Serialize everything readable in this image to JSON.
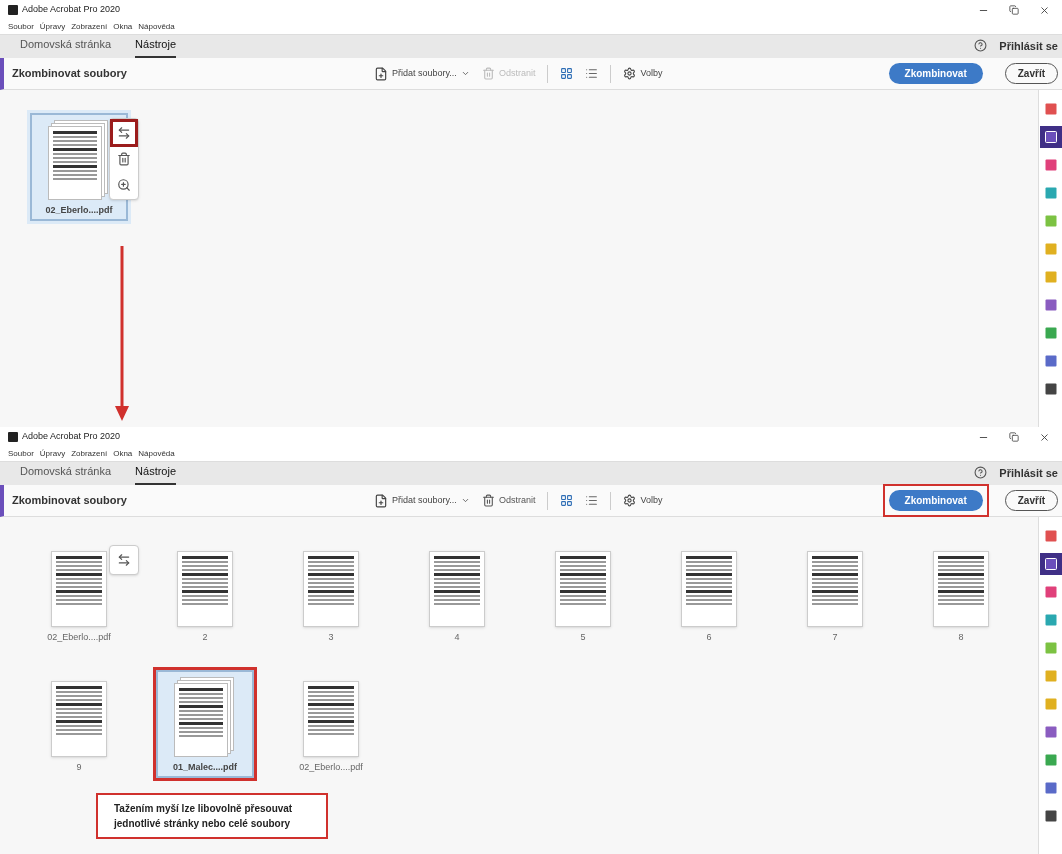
{
  "windows": [
    {
      "title": "Adobe Acrobat Pro 2020",
      "menu": [
        "Soubor",
        "Úpravy",
        "Zobrazení",
        "Okna",
        "Nápověda"
      ],
      "tabs": [
        {
          "label": "Domovská stránka",
          "selected": false
        },
        {
          "label": "Nástroje",
          "selected": true
        }
      ],
      "sign_in": "Přihlásit se",
      "toolbar": {
        "title": "Zkombinovat soubory",
        "add_files": "Přidat soubory...",
        "remove": {
          "label": "Odstranit",
          "disabled": true
        },
        "view_modes": [
          {
            "kind": "grid",
            "selected": true
          },
          {
            "kind": "list",
            "selected": false
          }
        ],
        "options": "Volby"
      },
      "combine_button": {
        "label": "Zkombinovat",
        "highlighted": false
      },
      "close_button": "Zavřít",
      "tools": [
        {
          "color": "#e05050",
          "selected": false
        },
        {
          "color": "#6b4fbb",
          "selected": true
        },
        {
          "color": "#e0407a",
          "selected": false
        },
        {
          "color": "#2aa8b0",
          "selected": false
        },
        {
          "color": "#7cc242",
          "selected": false
        },
        {
          "color": "#e0b020",
          "selected": false
        },
        {
          "color": "#e0b020",
          "selected": false
        },
        {
          "color": "#8a5cc0",
          "selected": false
        },
        {
          "color": "#3aa850",
          "selected": false
        },
        {
          "color": "#5a6ac8",
          "selected": false
        },
        {
          "color": "#444444",
          "selected": false
        }
      ],
      "rows": [
        [
          {
            "label": "02_Eberlo....pdf",
            "kind": "file",
            "selected": true,
            "highlighted": false,
            "actions": [
              {
                "kind": "swap",
                "highlighted": true
              },
              {
                "kind": "delete",
                "highlighted": false
              },
              {
                "kind": "zoom",
                "highlighted": false
              }
            ]
          }
        ]
      ]
    },
    {
      "title": "Adobe Acrobat Pro 2020",
      "menu": [
        "Soubor",
        "Úpravy",
        "Zobrazení",
        "Okna",
        "Nápověda"
      ],
      "tabs": [
        {
          "label": "Domovská stránka",
          "selected": false
        },
        {
          "label": "Nástroje",
          "selected": true
        }
      ],
      "sign_in": "Přihlásit se",
      "toolbar": {
        "title": "Zkombinovat soubory",
        "add_files": "Přidat soubory...",
        "remove": {
          "label": "Odstranit",
          "disabled": false
        },
        "view_modes": [
          {
            "kind": "grid",
            "selected": true
          },
          {
            "kind": "list",
            "selected": false
          }
        ],
        "options": "Volby"
      },
      "combine_button": {
        "label": "Zkombinovat",
        "highlighted": true
      },
      "close_button": "Zavřít",
      "tools": [
        {
          "color": "#e05050",
          "selected": false
        },
        {
          "color": "#6b4fbb",
          "selected": true
        },
        {
          "color": "#e0407a",
          "selected": false
        },
        {
          "color": "#2aa8b0",
          "selected": false
        },
        {
          "color": "#7cc242",
          "selected": false
        },
        {
          "color": "#e0b020",
          "selected": false
        },
        {
          "color": "#e0b020",
          "selected": false
        },
        {
          "color": "#8a5cc0",
          "selected": false
        },
        {
          "color": "#3aa850",
          "selected": false
        },
        {
          "color": "#5a6ac8",
          "selected": false
        },
        {
          "color": "#444444",
          "selected": false
        }
      ],
      "rows": [
        [
          {
            "label": "02_Eberlo....pdf",
            "kind": "page",
            "selected": false,
            "highlighted": false,
            "actions": [
              {
                "kind": "swap",
                "highlighted": false
              }
            ]
          },
          {
            "label": "2",
            "kind": "page",
            "selected": false,
            "highlighted": false
          },
          {
            "label": "3",
            "kind": "page",
            "selected": false,
            "highlighted": false
          },
          {
            "label": "4",
            "kind": "page",
            "selected": false,
            "highlighted": false
          },
          {
            "label": "5",
            "kind": "page",
            "selected": false,
            "highlighted": false
          },
          {
            "label": "6",
            "kind": "page",
            "selected": false,
            "highlighted": false
          },
          {
            "label": "7",
            "kind": "page",
            "selected": false,
            "highlighted": false
          },
          {
            "label": "8",
            "kind": "page",
            "selected": false,
            "highlighted": false
          }
        ],
        [
          {
            "label": "9",
            "kind": "page",
            "selected": false,
            "highlighted": false
          },
          {
            "label": "01_Malec....pdf",
            "kind": "file",
            "selected": true,
            "highlighted": true
          },
          {
            "label": "02_Eberlo....pdf",
            "kind": "page",
            "selected": false,
            "highlighted": false
          }
        ]
      ],
      "note": "Tažením myší lze libovolně přesouvat jednotlivé stránky nebo celé soubory"
    }
  ]
}
